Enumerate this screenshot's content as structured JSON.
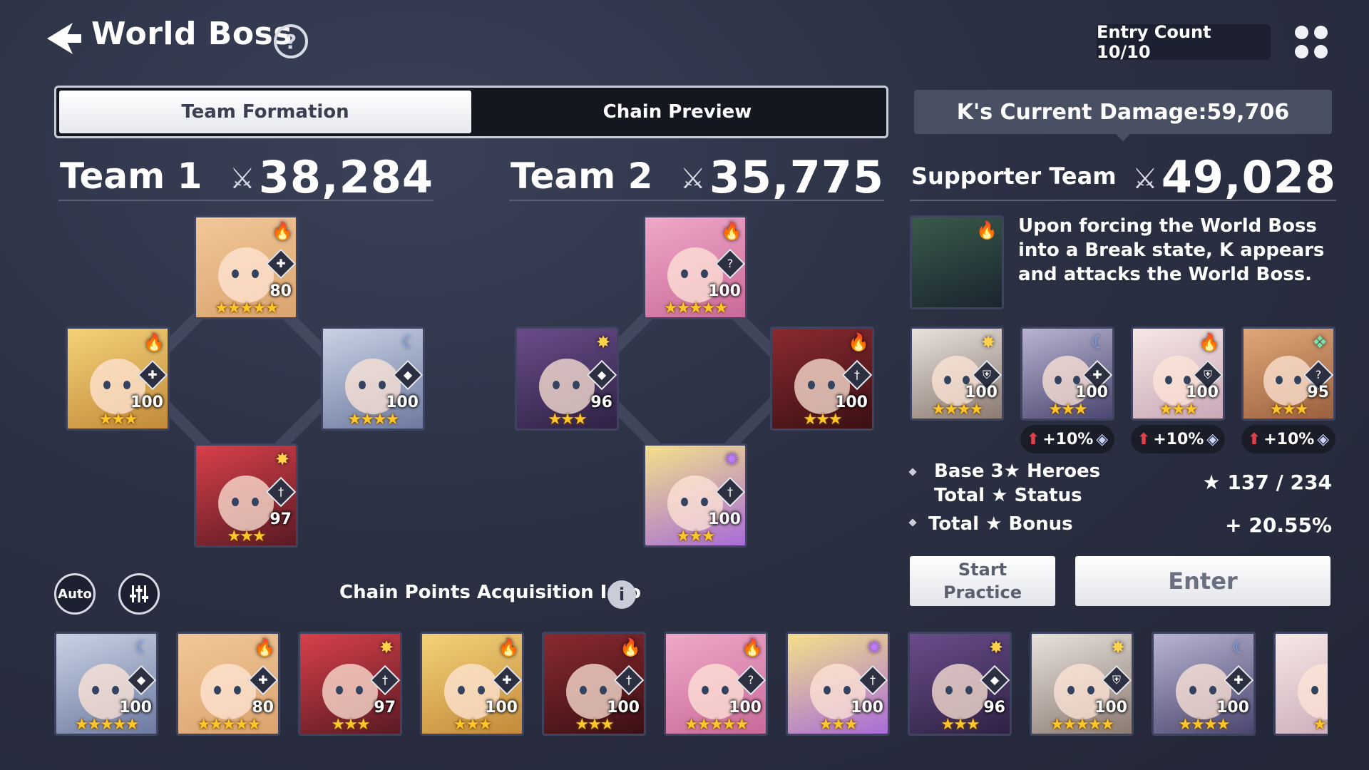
{
  "header": {
    "title": "World Boss",
    "help_symbol": "?",
    "entry_count": "Entry Count 10/10"
  },
  "tabs": [
    {
      "label": "Team Formation",
      "active": true
    },
    {
      "label": "Chain Preview",
      "active": false
    }
  ],
  "current_damage": "K's Current Damage:59,706",
  "team1": {
    "name": "Team 1",
    "power": "38,284",
    "heroes": [
      {
        "pos": "top",
        "level": "80",
        "stars": "★★★★★",
        "element": "fire",
        "role": "support",
        "palette": [
          "#f2c899",
          "#d9a36e"
        ]
      },
      {
        "pos": "left",
        "level": "100",
        "stars": "★★★",
        "element": "fire",
        "role": "support",
        "palette": [
          "#f4d27a",
          "#c28a3a"
        ]
      },
      {
        "pos": "right",
        "level": "100",
        "stars": "★★★★",
        "element": "water",
        "role": "defender",
        "palette": [
          "#c9d2e4",
          "#6d7aa0"
        ]
      },
      {
        "pos": "bottom",
        "level": "97",
        "stars": "★★★",
        "element": "light",
        "role": "attacker",
        "palette": [
          "#d8404a",
          "#5a1a24"
        ]
      }
    ]
  },
  "team2": {
    "name": "Team 2",
    "power": "35,775",
    "heroes": [
      {
        "pos": "top",
        "level": "100",
        "stars": "★★★★★",
        "element": "fire",
        "role": "special",
        "palette": [
          "#f0a8c8",
          "#c96a9a"
        ]
      },
      {
        "pos": "left",
        "level": "96",
        "stars": "★★★",
        "element": "light",
        "role": "defender",
        "palette": [
          "#6a4c8a",
          "#2e2244"
        ]
      },
      {
        "pos": "right",
        "level": "100",
        "stars": "★★★",
        "element": "fire",
        "role": "attacker",
        "palette": [
          "#8a2a30",
          "#3a1014"
        ]
      },
      {
        "pos": "bottom",
        "level": "100",
        "stars": "★★★",
        "element": "dark",
        "role": "attacker",
        "palette": [
          "#f4e08a",
          "#a86cd8"
        ]
      }
    ]
  },
  "supporter": {
    "name": "Supporter Team",
    "power": "49,028",
    "description": "Upon forcing the World Boss into a Break state, K appears and attacks the World Boss.",
    "portrait_palette": [
      "#3a5a4a",
      "#1a2430"
    ],
    "heroes": [
      {
        "level": "100",
        "stars": "★★★★",
        "element": "light",
        "role": "tank",
        "palette": [
          "#e8e2dc",
          "#8a7a72"
        ]
      },
      {
        "level": "100",
        "stars": "★★★",
        "element": "water",
        "role": "support",
        "palette": [
          "#b8b4d0",
          "#4a4670"
        ]
      },
      {
        "level": "100",
        "stars": "★★★",
        "element": "fire",
        "role": "tank",
        "palette": [
          "#f6e8e4",
          "#c9a8b8"
        ]
      },
      {
        "level": "95",
        "stars": "★★★",
        "element": "wind",
        "role": "special",
        "palette": [
          "#e0a878",
          "#9a6040"
        ]
      }
    ],
    "bonuses": [
      {
        "text": "+10%",
        "icon": "water-icon"
      },
      {
        "text": "+10%",
        "icon": "tank-icon"
      },
      {
        "text": "+10%",
        "icon": "special-icon"
      }
    ]
  },
  "stats": [
    {
      "label": "Base 3★ Heroes Total ★ Status",
      "value": "★ 137 / 234"
    },
    {
      "label": "Total ★ Bonus",
      "value": "+ 20.55%"
    }
  ],
  "buttons": {
    "practice": "Start Practice",
    "enter": "Enter",
    "auto": "Auto"
  },
  "chain_info_label": "Chain Points Acquisition Info",
  "chain_info_symbol": "i",
  "roster": [
    {
      "level": "100",
      "stars": "★★★★★",
      "element": "water",
      "role": "defender",
      "palette": [
        "#c9d2e4",
        "#6d7aa0"
      ]
    },
    {
      "level": "80",
      "stars": "★★★★★",
      "element": "fire",
      "role": "support",
      "palette": [
        "#f2c899",
        "#d9a36e"
      ]
    },
    {
      "level": "97",
      "stars": "★★★",
      "element": "light",
      "role": "attacker",
      "palette": [
        "#d8404a",
        "#5a1a24"
      ]
    },
    {
      "level": "100",
      "stars": "★★★",
      "element": "fire",
      "role": "support",
      "palette": [
        "#f4d27a",
        "#c28a3a"
      ]
    },
    {
      "level": "100",
      "stars": "★★★",
      "element": "fire",
      "role": "attacker",
      "palette": [
        "#8a2a30",
        "#3a1014"
      ]
    },
    {
      "level": "100",
      "stars": "★★★★★",
      "element": "fire",
      "role": "special",
      "palette": [
        "#f0a8c8",
        "#c96a9a"
      ]
    },
    {
      "level": "100",
      "stars": "★★★",
      "element": "dark",
      "role": "attacker",
      "palette": [
        "#f4e08a",
        "#a86cd8"
      ]
    },
    {
      "level": "96",
      "stars": "★★★",
      "element": "light",
      "role": "defender",
      "palette": [
        "#6a4c8a",
        "#2e2244"
      ]
    },
    {
      "level": "100",
      "stars": "★★★★★",
      "element": "light",
      "role": "tank",
      "palette": [
        "#e8e2dc",
        "#8a7a72"
      ]
    },
    {
      "level": "100",
      "stars": "★★★★",
      "element": "water",
      "role": "support",
      "palette": [
        "#b8b4d0",
        "#4a4670"
      ]
    },
    {
      "level": "",
      "stars": "★★",
      "element": "fire",
      "role": "tank",
      "palette": [
        "#f6e8e4",
        "#c9a8b8"
      ]
    }
  ]
}
